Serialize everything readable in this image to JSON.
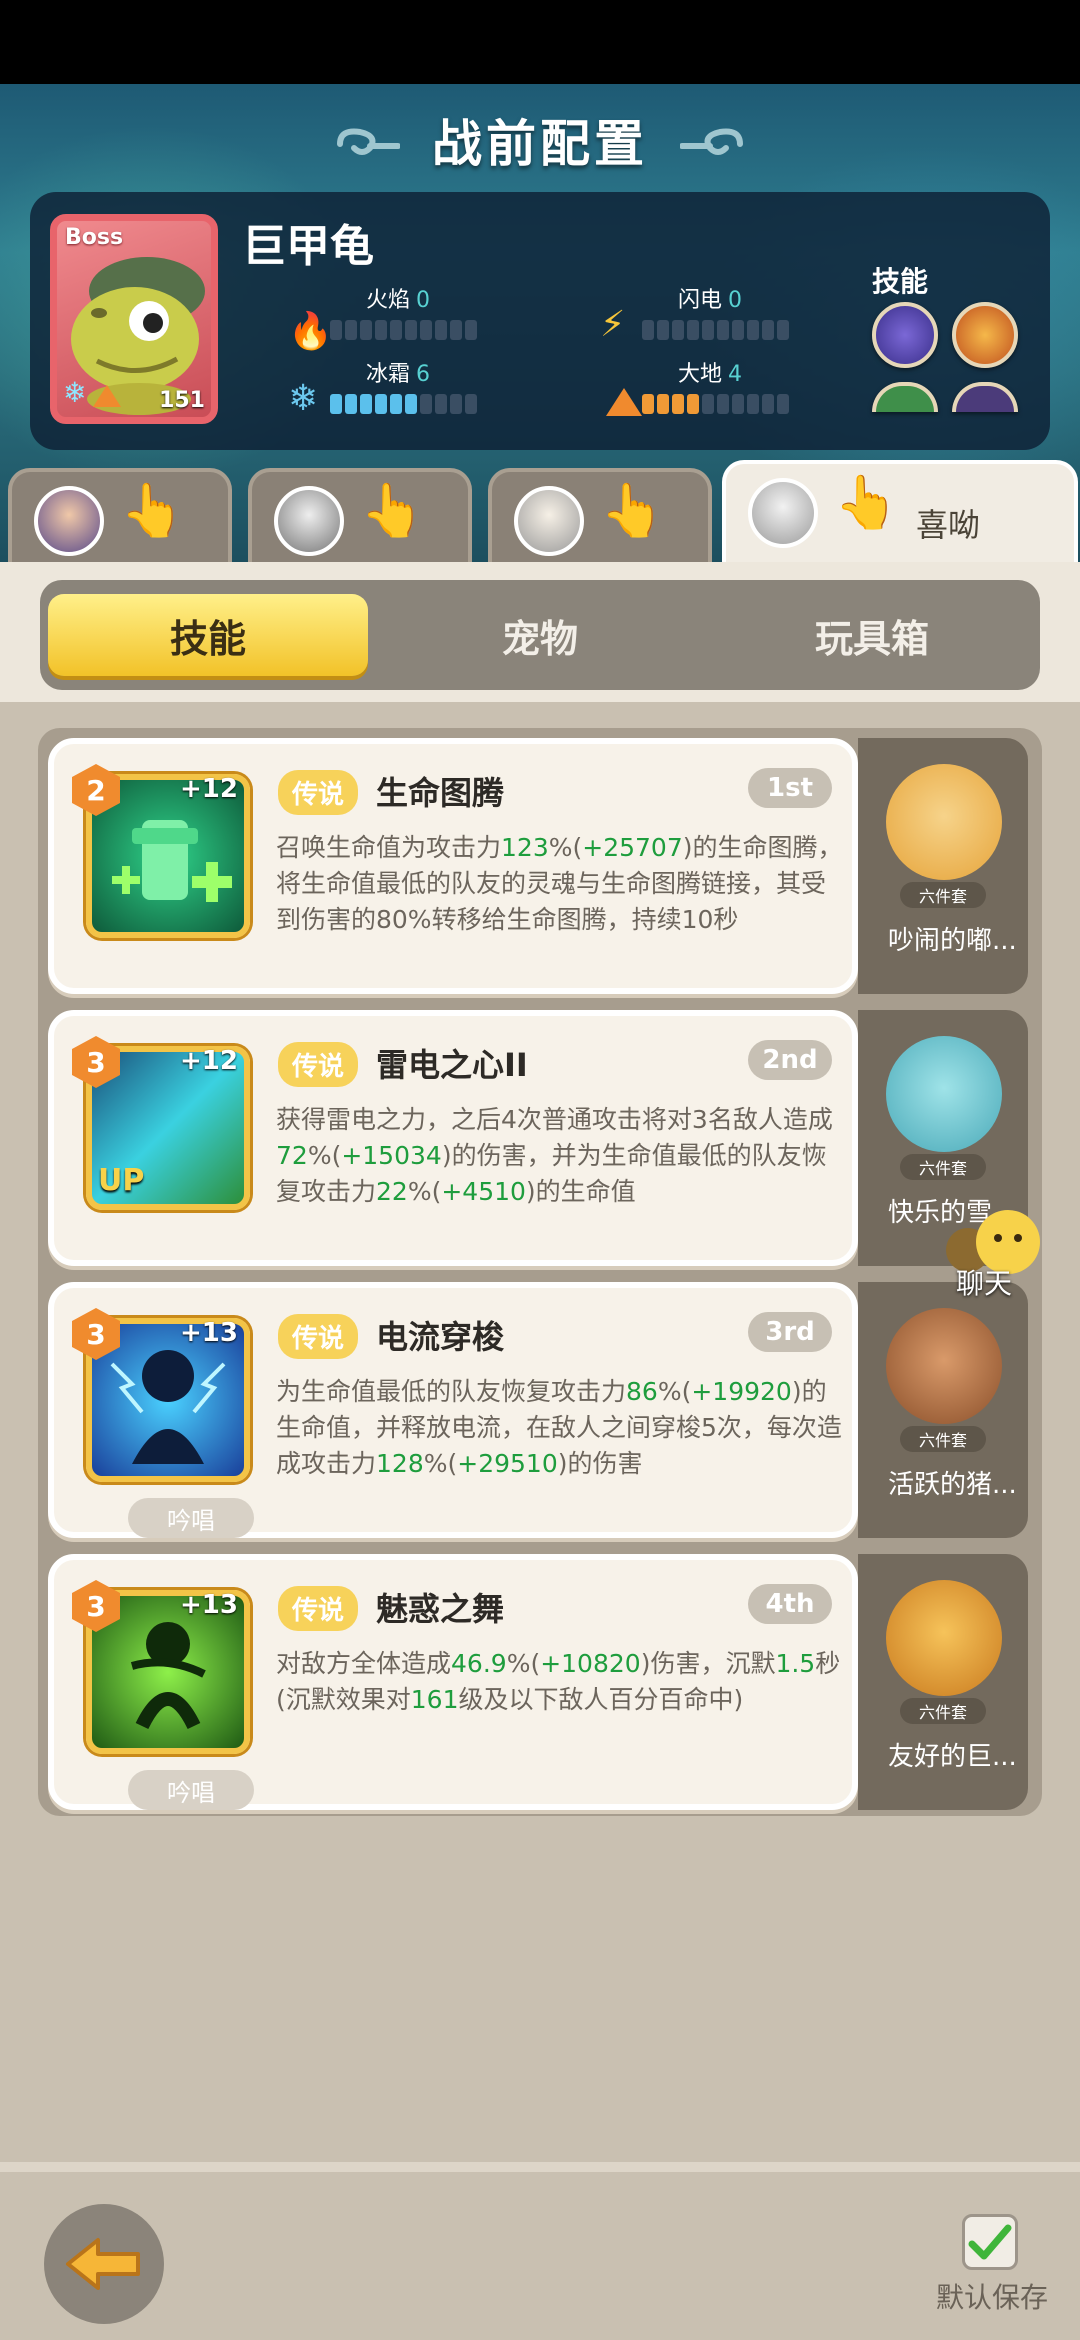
{
  "header": {
    "title": "战前配置"
  },
  "boss": {
    "tag": "Boss",
    "name": "巨甲龟",
    "level": "151",
    "skills_label": "技能",
    "elements": [
      {
        "name": "火焰",
        "value": "0",
        "fill": 0,
        "icon": "fire-icon"
      },
      {
        "name": "闪电",
        "value": "0",
        "fill": 0,
        "icon": "lightning-icon"
      },
      {
        "name": "冰霜",
        "value": "6",
        "fill": 6,
        "icon": "frost-icon"
      },
      {
        "name": "大地",
        "value": "4",
        "fill": 4,
        "icon": "earth-icon"
      }
    ]
  },
  "heroes": [
    {
      "label": ""
    },
    {
      "label": ""
    },
    {
      "label": ""
    },
    {
      "label": "喜呦"
    }
  ],
  "categories": [
    "技能",
    "宠物",
    "玩具箱"
  ],
  "skills": [
    {
      "level": "2",
      "plus": "+12",
      "legend": "传说",
      "name": "生命图腾",
      "rank": "1st",
      "desc": [
        [
          "召唤生命值为攻击力",
          ""
        ],
        [
          "123",
          "hl"
        ],
        [
          "%(",
          ""
        ],
        [
          "+25707",
          "hl"
        ],
        [
          ")的生命图腾，将生命值最低的队友的灵魂与生命图腾链接，其受到伤害的80%转移给生命图腾，持续10秒",
          ""
        ]
      ],
      "chant": ""
    },
    {
      "level": "3",
      "plus": "+12",
      "legend": "传说",
      "name": "雷电之心II",
      "rank": "2nd",
      "desc": [
        [
          "获得雷电之力，之后4次普通攻击将对3名敌人造成",
          ""
        ],
        [
          "72",
          "hl"
        ],
        [
          "%(",
          ""
        ],
        [
          "+15034",
          "hl"
        ],
        [
          ")的伤害，并为生命值最低的队友恢复攻击力",
          ""
        ],
        [
          "22",
          "hl"
        ],
        [
          "%(",
          ""
        ],
        [
          "+4510",
          "hl"
        ],
        [
          ")的生命值",
          ""
        ]
      ],
      "chant": ""
    },
    {
      "level": "3",
      "plus": "+13",
      "legend": "传说",
      "name": "电流穿梭",
      "rank": "3rd",
      "desc": [
        [
          "为生命值最低的队友恢复攻击力",
          ""
        ],
        [
          "86",
          "hl"
        ],
        [
          "%(",
          ""
        ],
        [
          "+19920",
          "hl"
        ],
        [
          ")的生命值，并释放电流，在敌人之间穿梭5次，每次造成攻击力",
          ""
        ],
        [
          "128",
          "hl"
        ],
        [
          "%(",
          ""
        ],
        [
          "+29510",
          "hl"
        ],
        [
          ")的伤害",
          ""
        ]
      ],
      "chant": "吟唱"
    },
    {
      "level": "3",
      "plus": "+13",
      "legend": "传说",
      "name": "魅惑之舞",
      "rank": "4th",
      "desc": [
        [
          "对敌方全体造成",
          ""
        ],
        [
          "46.9",
          "hl"
        ],
        [
          "%(",
          ""
        ],
        [
          "+10820",
          "hl"
        ],
        [
          ")伤害，沉默",
          ""
        ],
        [
          "1.5",
          "hl"
        ],
        [
          "秒(沉默效果对",
          ""
        ],
        [
          "161",
          "hl"
        ],
        [
          "级及以下敌人百分百命中)",
          ""
        ]
      ],
      "chant": "吟唱"
    }
  ],
  "pets": [
    {
      "set": "六件套",
      "name": "吵闹的嘟..."
    },
    {
      "set": "六件套",
      "name": "快乐的雪..."
    },
    {
      "set": "六件套",
      "name": "活跃的猪..."
    },
    {
      "set": "六件套",
      "name": "友好的巨..."
    }
  ],
  "chat": {
    "label": "聊天"
  },
  "footer": {
    "save_label": "默认保存"
  }
}
